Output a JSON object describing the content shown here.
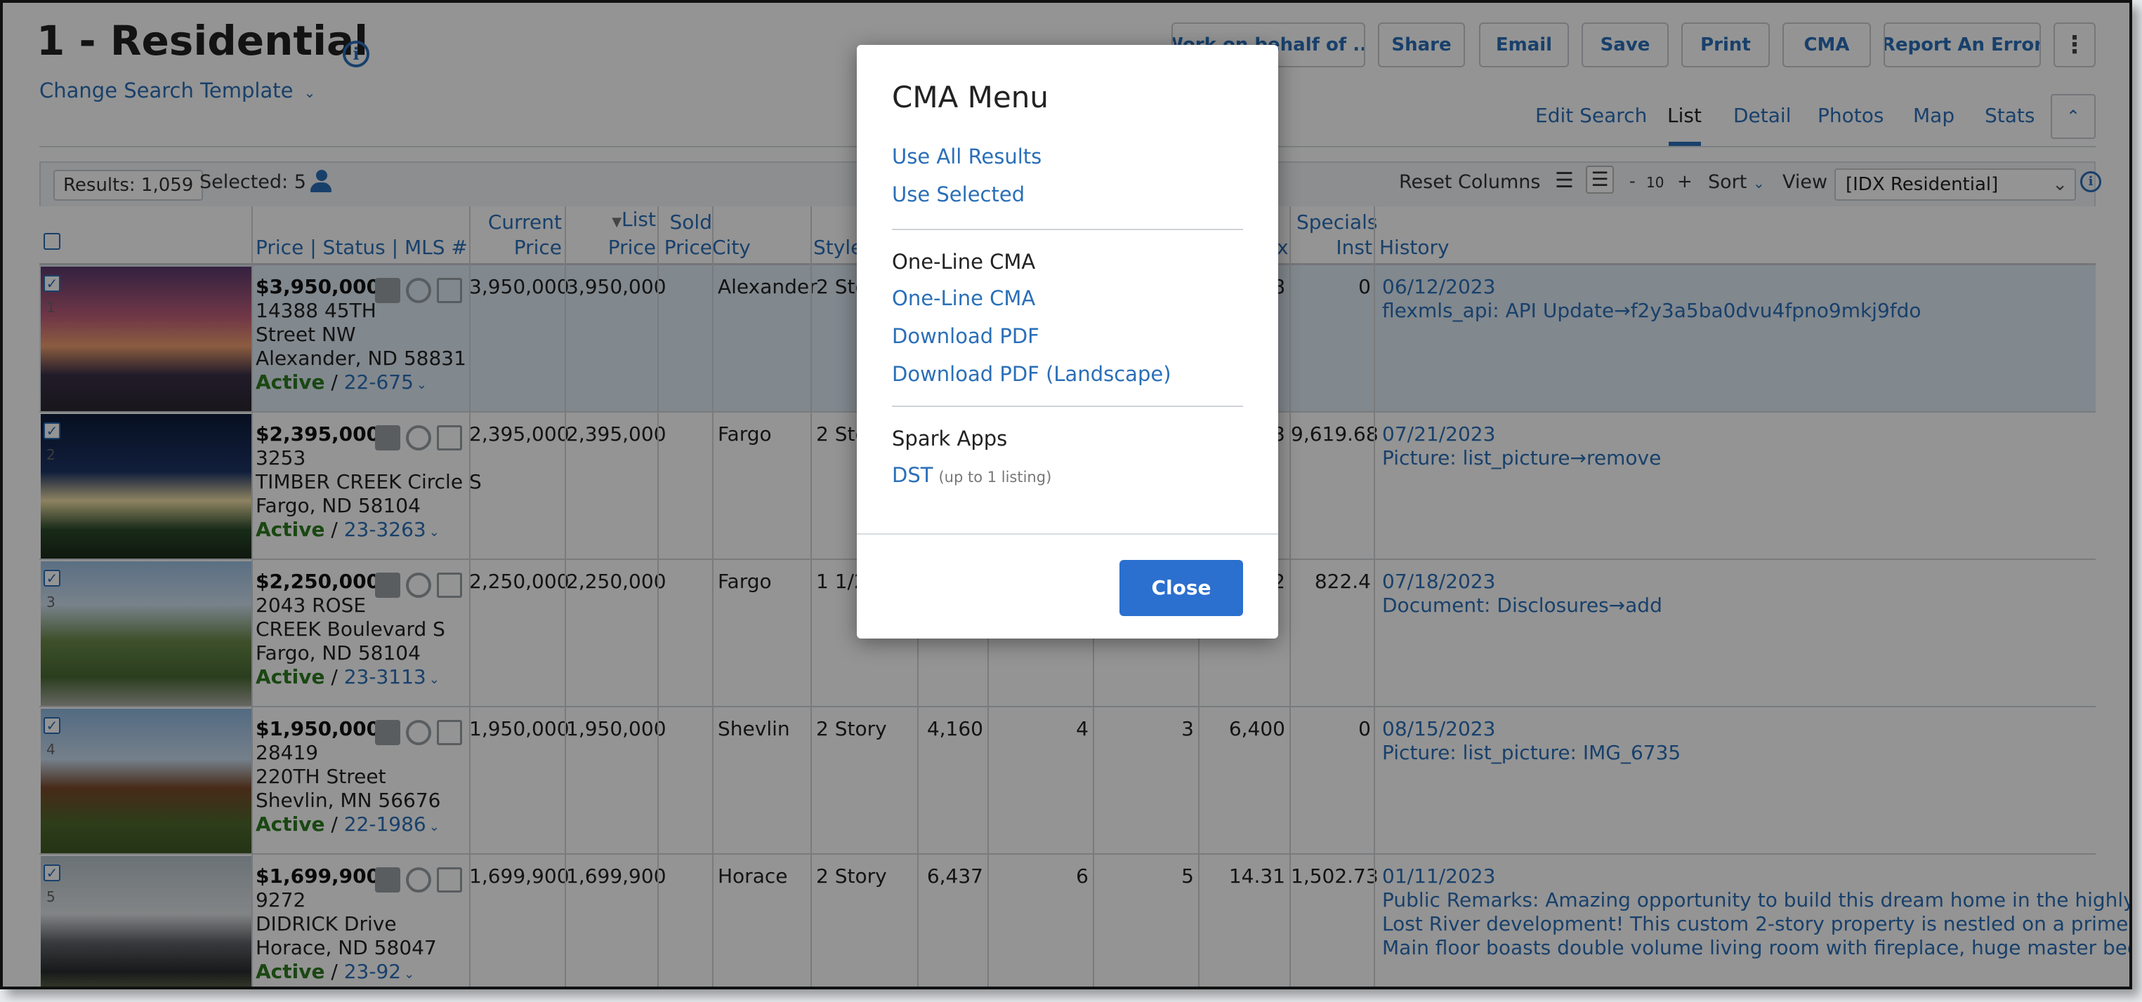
{
  "page": {
    "title": "1 - Residential",
    "template_link": "Change Search Template",
    "action_buttons": [
      "Work on behalf of ...",
      "Share",
      "Email",
      "Save",
      "Print",
      "CMA",
      "Report An Error"
    ],
    "view_tabs": [
      "Edit Search",
      "List",
      "Detail",
      "Photos",
      "Map",
      "Stats"
    ],
    "active_view": "List"
  },
  "toolbar": {
    "results": "Results: 1,059",
    "selected": "Selected: 5",
    "reset_columns": "Reset Columns",
    "page_size_minus": "-",
    "page_size": "10",
    "page_size_plus": "+",
    "sort_label": "Sort",
    "view_label": "View",
    "view_value": "[IDX Residential]"
  },
  "table": {
    "headers": {
      "price_status_mls": "Price  |  Status  |  MLS #",
      "current_price": [
        "Current",
        "Price"
      ],
      "list_price": [
        "List",
        "Price"
      ],
      "sold_price": [
        "Sold",
        "Price"
      ],
      "city": "City",
      "style": "Style",
      "col_x": "x",
      "specials": [
        "Specials",
        "Inst"
      ],
      "history": "History"
    },
    "rows": [
      {
        "num": "1",
        "price": "$3,950,000",
        "addr1": "14388 45TH",
        "addr2": "Street NW",
        "addr3": "Alexander, ND 58831",
        "status": "Active",
        "mls": "22-675",
        "current": "3,950,000",
        "list": "3,950,000",
        "city": "Alexander",
        "style": "2 Sto",
        "c5": "",
        "c6": "",
        "c7": "",
        "c8": "8",
        "c9": "0",
        "hist_date": "06/12/2023",
        "hist_text": "flexmls_api: API Update→f2y3a5ba0dvu4fpno9mkj9fdo",
        "hist_more": []
      },
      {
        "num": "2",
        "price": "$2,395,000",
        "addr1": "3253",
        "addr2": "TIMBER CREEK Circle S",
        "addr3": "Fargo, ND 58104",
        "status": "Active",
        "mls": "23-3263",
        "current": "2,395,000",
        "list": "2,395,000",
        "city": "Fargo",
        "style": "2 Sto",
        "c5": "",
        "c6": "",
        "c7": "",
        "c8": "3",
        "c9": "9,619.68",
        "hist_date": "07/21/2023",
        "hist_text": "Picture: list_picture→remove",
        "hist_more": []
      },
      {
        "num": "3",
        "price": "$2,250,000",
        "addr1": "2043 ROSE",
        "addr2": "CREEK Boulevard S",
        "addr3": "Fargo, ND 58104",
        "status": "Active",
        "mls": "23-3113",
        "current": "2,250,000",
        "list": "2,250,000",
        "city": "Fargo",
        "style": "1 1/2",
        "c5": "",
        "c6": "",
        "c7": "",
        "c8": "2",
        "c9": "822.4",
        "hist_date": "07/18/2023",
        "hist_text": "Document: Disclosures→add",
        "hist_more": []
      },
      {
        "num": "4",
        "price": "$1,950,000",
        "addr1": "28419",
        "addr2": "220TH Street",
        "addr3": "Shevlin, MN 56676",
        "status": "Active",
        "mls": "22-1986",
        "current": "1,950,000",
        "list": "1,950,000",
        "city": "Shevlin",
        "style": "2 Story",
        "c5": "4,160",
        "c6": "4",
        "c7": "3",
        "c8": "6,400",
        "c9": "0",
        "hist_date": "08/15/2023",
        "hist_text": "Picture: list_picture: IMG_6735",
        "hist_more": []
      },
      {
        "num": "5",
        "price": "$1,699,900",
        "addr1": "9272",
        "addr2": "DIDRICK Drive",
        "addr3": "Horace, ND 58047",
        "status": "Active",
        "mls": "23-92",
        "current": "1,699,900",
        "list": "1,699,900",
        "city": "Horace",
        "style": "2 Story",
        "c5": "6,437",
        "c6": "6",
        "c7": "5",
        "c8": "14.31",
        "c9": "1,502.73",
        "hist_date": "01/11/2023",
        "hist_text": "Public Remarks: Amazing opportunity to build this dream home in the highly covet",
        "hist_more": [
          "Lost River development! This custom 2-story property is nestled on a prime river lo",
          "Main floor boasts double volume living room with fireplace, huge master bedroom"
        ]
      }
    ]
  },
  "modal": {
    "title": "CMA Menu",
    "links_top": [
      "Use All Results",
      "Use Selected"
    ],
    "section1_title": "One-Line CMA",
    "section1_links": [
      "One-Line CMA",
      "Download PDF",
      "Download PDF (Landscape)"
    ],
    "section2_title": "Spark Apps",
    "section2_link": "DST",
    "section2_note": "(up to 1 listing)",
    "close_label": "Close"
  },
  "colors": {
    "accent": "#2a6fb8",
    "status_active": "#2d7a1f",
    "close_button": "#2b6fcf"
  }
}
